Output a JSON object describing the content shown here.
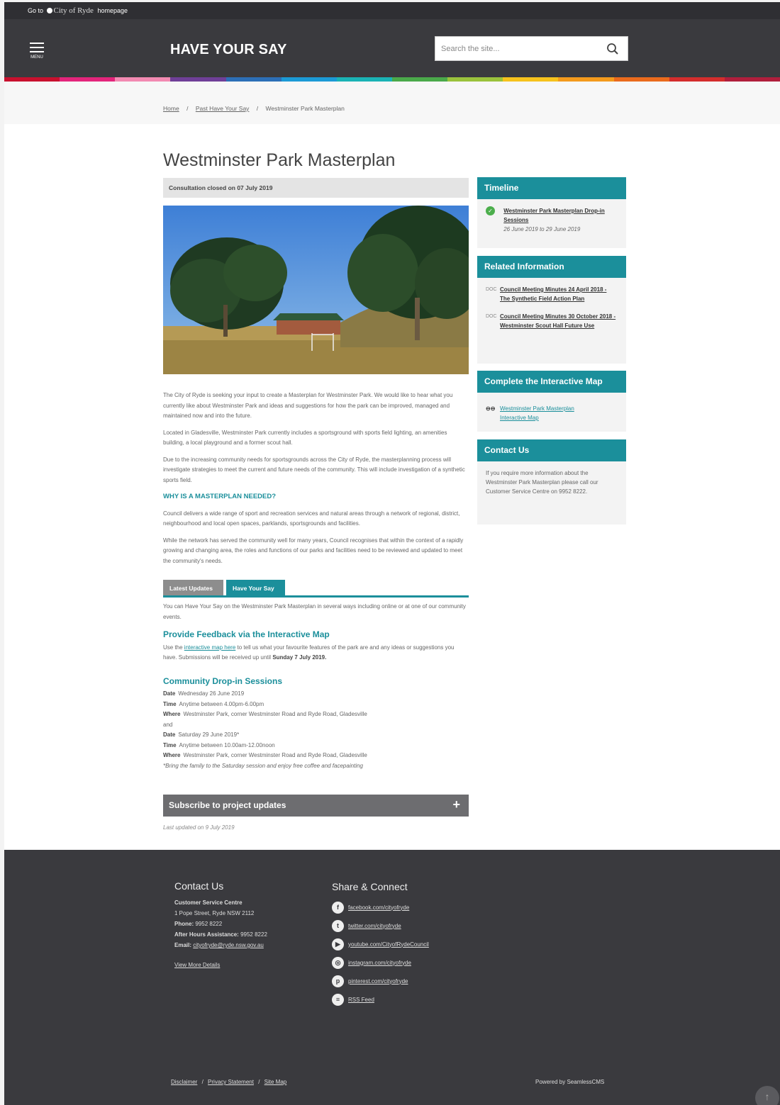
{
  "topbar": {
    "prefix": "Go to",
    "brand": "City of Ryde",
    "suffix": "homepage"
  },
  "header": {
    "menu_label": "MENU",
    "site_title": "HAVE YOUR SAY",
    "search_placeholder": "Search the site..."
  },
  "rainbow_colors": [
    "#c8102e",
    "#e3257b",
    "#f28ab2",
    "#6f3f98",
    "#2c6fb7",
    "#1b9ad6",
    "#1ab3b5",
    "#4aa94a",
    "#9ac23c",
    "#f6c21c",
    "#f39a1c",
    "#ea6a1c",
    "#d42d2d",
    "#b01e3c"
  ],
  "breadcrumb": {
    "home": "Home",
    "past": "Past Have Your Say",
    "current": "Westminster Park Masterplan"
  },
  "main": {
    "title": "Westminster Park Masterplan",
    "closed_notice": "Consultation closed on 07 July 2019",
    "paragraphs": [
      "The City of Ryde is seeking your input to create a Masterplan for Westminster Park. We would like to hear what you currently like about Westminster Park and ideas and suggestions for how the park can be improved, managed and maintained now and into the future.",
      "Located in Gladesville, Westminster Park currently includes a sportsground with sports field lighting, an amenities building, a local playground and a former scout hall.",
      "Due to the increasing community needs for sportsgrounds across the City of Ryde, the masterplanning process will investigate strategies to meet the current and future needs of the community. This will include investigation of a synthetic sports field."
    ],
    "why_heading": "WHY IS A MASTERPLAN NEEDED?",
    "why_paragraphs": [
      "Council delivers a wide range of sport and recreation services and natural areas through a network of regional, district, neighbourhood and local open spaces, parklands, sportsgrounds and facilities.",
      "While the network has served the community well for many years, Council recognises that within the context of a rapidly growing and changing area, the roles and functions of our parks and facilities need to be reviewed and updated to meet the community's needs."
    ],
    "tabs": [
      "Latest Updates",
      "Have Your Say"
    ],
    "tab_intro": "You can Have Your Say on the Westminster Park Masterplan in several ways including online or at one of our community events.",
    "feedback_heading": "Provide Feedback via the Interactive Map",
    "feedback_pre": "Use the ",
    "feedback_link": "interactive map here",
    "feedback_post": " to tell us what your favourite features of the park are and any ideas or suggestions you have. Submissions will be received up until ",
    "feedback_date": "Sunday 7 July 2019.",
    "dropin_heading": "Community Drop-in Sessions",
    "events": [
      {
        "k": "Date",
        "v": "Wednesday 26 June 2019"
      },
      {
        "k": "Time",
        "v": "Anytime between 4.00pm-6.00pm"
      },
      {
        "k": "Where",
        "v": "Westminster Park, corner Westminster Road and Ryde Road, Gladesville"
      },
      {
        "k": "",
        "v": "and"
      },
      {
        "k": "Date",
        "v": "Saturday 29 June 2019*"
      },
      {
        "k": "Time",
        "v": "Anytime between 10.00am-12.00noon"
      },
      {
        "k": "Where",
        "v": "Westminster Park, corner Westminster Road and Ryde Road, Gladesville"
      }
    ],
    "event_note": "*Bring the family to the Saturday session and enjoy free coffee and facepainting",
    "subscribe": "Subscribe to project updates",
    "last_updated": "Last updated on 9 July 2019"
  },
  "sidebar": {
    "timeline": {
      "title": "Timeline",
      "item": "Westminster Park Masterplan Drop-in Sessions",
      "dates": "26 June 2019 to 29 June 2019"
    },
    "related": {
      "title": "Related Information",
      "items": [
        "Council Meeting Minutes 24 April 2018 - The Synthetic Field Action Plan",
        "Council Meeting Minutes 30 October 2018 - Westminster Scout Hall Future Use"
      ],
      "doc_tag": "DOC"
    },
    "map": {
      "title": "Complete the Interactive Map",
      "link": "Westminster Park Masterplan Interactive Map"
    },
    "contact": {
      "title": "Contact Us",
      "text": "If you require more information about the Westminster Park Masterplan please call our Customer Service Centre on 9952 8222."
    }
  },
  "footer": {
    "contact_title": "Contact Us",
    "centre": "Customer Service Centre",
    "address": "1 Pope Street, Ryde NSW 2112",
    "phone_label": "Phone:",
    "phone": "9952 8222",
    "after_label": "After Hours Assistance:",
    "after": "9952 8222",
    "email_label": "Email:",
    "email": "cityofryde@ryde.nsw.gov.au",
    "more": "View More Details",
    "share_title": "Share & Connect",
    "social": [
      {
        "icon": "facebook-icon",
        "glyph": "f",
        "text": "facebook.com/cityofryde"
      },
      {
        "icon": "twitter-icon",
        "glyph": "t",
        "text": "twitter.com/cityofryde"
      },
      {
        "icon": "youtube-icon",
        "glyph": "▶",
        "text": "youtube.com/CityofRydeCouncil"
      },
      {
        "icon": "instagram-icon",
        "glyph": "◎",
        "text": "instagram.com/cityofryde"
      },
      {
        "icon": "pinterest-icon",
        "glyph": "p",
        "text": "pinterest.com/cityofryde"
      },
      {
        "icon": "rss-icon",
        "glyph": "≡",
        "text": "RSS Feed"
      }
    ],
    "links": [
      "Disclaimer",
      "Privacy Statement",
      "Site Map"
    ],
    "powered": "Powered by SeamlessCMS"
  }
}
